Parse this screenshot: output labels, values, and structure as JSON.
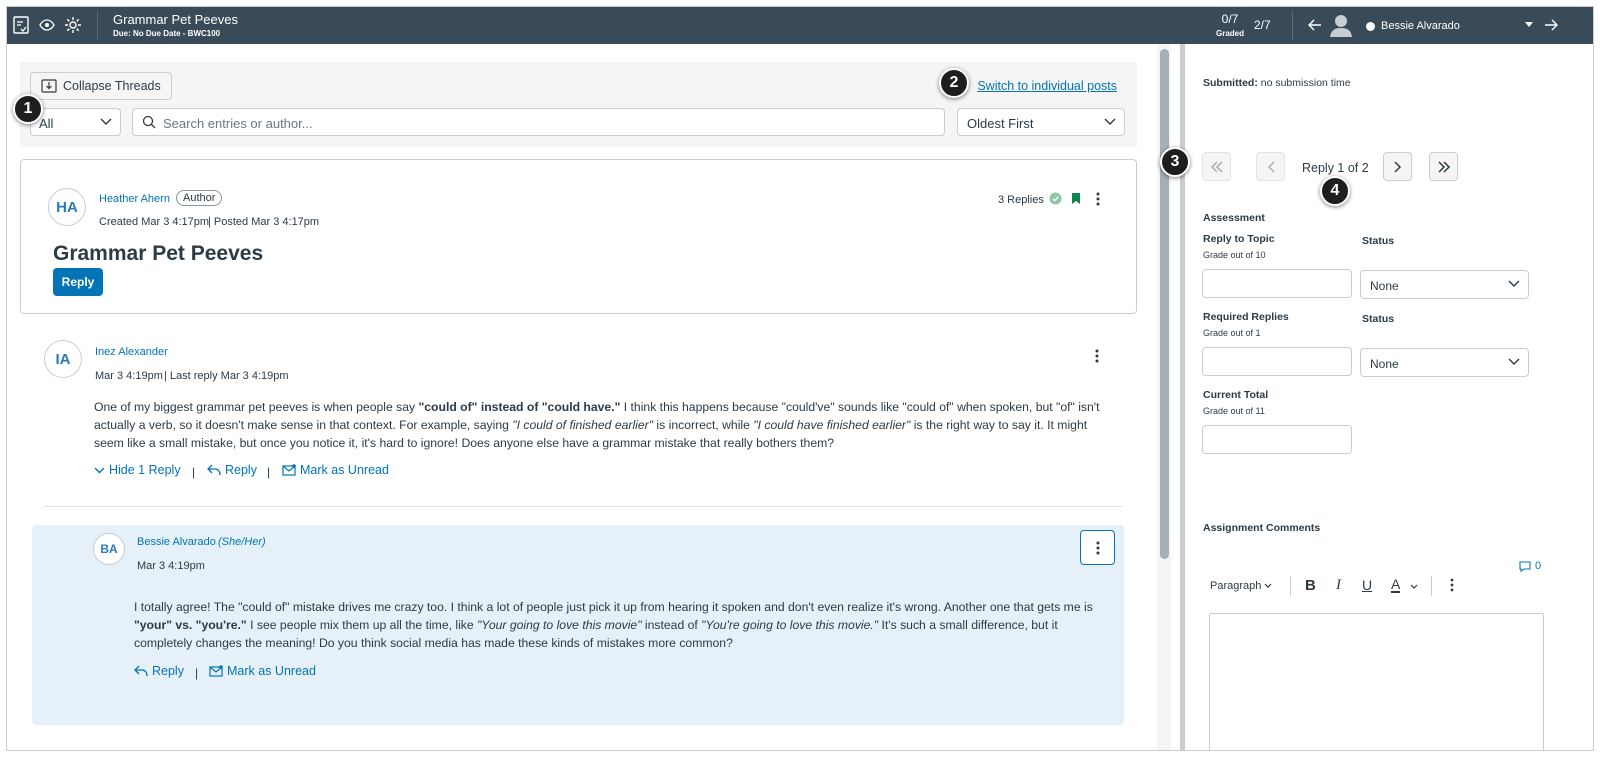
{
  "header": {
    "title": "Grammar Pet Peeves",
    "subtitle": "Due: No Due Date - BWC100",
    "graded_count": "0/7",
    "graded_label": "Graded",
    "student_position": "2/7",
    "student_name": "Bessie Alvarado"
  },
  "toolbar": {
    "collapse_label": "Collapse Threads",
    "switch_link": "Switch to individual posts",
    "filter_value": "All",
    "search_placeholder": "Search entries or author...",
    "sort_value": "Oldest First"
  },
  "callouts": [
    "1",
    "2",
    "3",
    "4"
  ],
  "topic": {
    "initials": "HA",
    "author": "Heather Ahern",
    "role_badge": "Author",
    "created": "Created Mar 3 4:17pm",
    "posted": "| Posted Mar 3 4:17pm",
    "title": "Grammar Pet Peeves",
    "reply_label": "Reply",
    "replies_count": "3 Replies"
  },
  "entry1": {
    "initials": "IA",
    "author": "Inez Alexander",
    "date": "Mar 3 4:19pm",
    "last_reply": "| Last reply Mar 3 4:19pm",
    "body": [
      {
        "t": "One of my biggest grammar pet peeves is when people say "
      },
      {
        "t": "\"could of\" instead of \"could have.\"",
        "s": "b"
      },
      {
        "t": " I think this happens because \"could've\" sounds like \"could of\" when spoken, but \"of\" isn't actually a verb, so it doesn't make sense in that context. For example, saying "
      },
      {
        "t": "\"I could of finished earlier\"",
        "s": "i"
      },
      {
        "t": " is incorrect, while "
      },
      {
        "t": "\"I could have finished earlier\"",
        "s": "i"
      },
      {
        "t": " is the right way to say it. It might seem like a small mistake, but once you notice it, it's hard to ignore! Does anyone else have a grammar mistake that really bothers them?"
      }
    ],
    "hide_reply": "Hide 1 Reply",
    "reply": "Reply",
    "mark_unread": "Mark as Unread"
  },
  "entry2": {
    "initials": "BA",
    "author": "Bessie Alvarado",
    "pronouns": "(She/Her)",
    "date": "Mar 3 4:19pm",
    "body": [
      {
        "t": "I totally agree! The \"could of\" mistake drives me crazy too. I think a lot of people just pick it up from hearing it spoken and don't even realize it's wrong. Another one that gets me is "
      },
      {
        "t": "\"your\" vs. \"you're.\"",
        "s": "b"
      },
      {
        "t": " I see people mix them up all the time, like "
      },
      {
        "t": "\"Your going to love this movie\"",
        "s": "i"
      },
      {
        "t": " instead of "
      },
      {
        "t": "\"You're going to love this movie.\"",
        "s": "i"
      },
      {
        "t": " It's such a small difference, but it completely changes the meaning! Do you think social media has made these kinds of mistakes more common?"
      }
    ],
    "reply": "Reply",
    "mark_unread": "Mark as Unread"
  },
  "grading": {
    "submitted_label": "Submitted:",
    "submitted_value": "no submission time",
    "reply_position": "Reply 1 of 2",
    "assessment": "Assessment",
    "reply_to_topic": "Reply to Topic",
    "reply_to_topic_grade": "Grade out of 10",
    "status_label": "Status",
    "status_value_1": "None",
    "required_replies": "Required Replies",
    "required_replies_grade": "Grade out of 1",
    "status_value_2": "None",
    "current_total": "Current Total",
    "current_total_grade": "Grade out of 11",
    "assignment_comments": "Assignment Comments",
    "comment_count": "0",
    "paragraph_label": "Paragraph"
  },
  "colors": {
    "header_bg": "#394b58",
    "link_blue": "#0374b5",
    "nested_bg": "#e5f0f8",
    "status_green": "#0b874b"
  }
}
